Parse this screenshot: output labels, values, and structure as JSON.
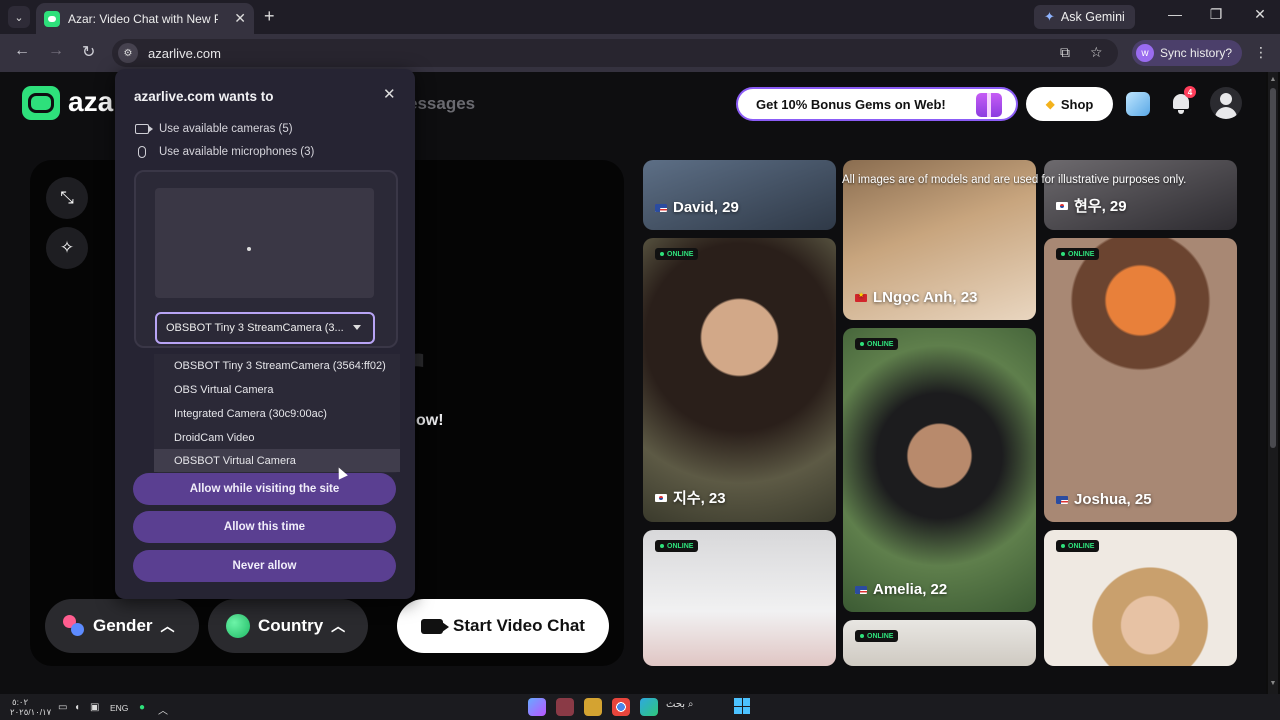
{
  "browser": {
    "tab_title": "Azar: Video Chat with New Peop",
    "url": "azarlive.com",
    "ask_gemini": "Ask Gemini",
    "sync": {
      "avatar_letter": "w",
      "label": "Sync history?"
    },
    "icons": [
      "tab-search-icon",
      "close-icon",
      "new-tab-icon",
      "back-icon",
      "forward-icon",
      "reload-icon",
      "site-info-icon",
      "install-app-icon",
      "bookmark-star-icon",
      "more-menu-icon",
      "minimize-icon",
      "maximize-icon"
    ]
  },
  "page": {
    "logo_text": "aza",
    "nav_messages": "essages",
    "promo": "Get 10% Bonus Gems on Web!",
    "shop": "Shop",
    "notification_count": "4",
    "ghost_letter": "r",
    "ghost_text": "ow!",
    "filters": {
      "gender": "Gender",
      "country": "Country"
    },
    "start_button": "Start Video Chat",
    "disclaimer": "All images are of models and are used for illustrative purposes only."
  },
  "cards": [
    {
      "label": "David, 29",
      "flag": "us",
      "online": false
    },
    {
      "label": "LNgọc Anh, 23",
      "flag": "vn",
      "online": false
    },
    {
      "label": "현우, 29",
      "flag": "kr",
      "online": false
    },
    {
      "label": "지수, 23",
      "flag": "kr",
      "online": true
    },
    {
      "label": "Amelia, 22",
      "flag": "us",
      "online": true
    },
    {
      "label": "Joshua, 25",
      "flag": "us",
      "online": true
    },
    {
      "label": "",
      "flag": "",
      "online": true
    },
    {
      "label": "",
      "flag": "",
      "online": true
    },
    {
      "label": "",
      "flag": "",
      "online": true
    }
  ],
  "online_text": "ONLINE",
  "permission": {
    "title": "azarlive.com wants to",
    "cameras": "Use available cameras (5)",
    "microphones": "Use available microphones (3)",
    "selected_camera": "OBSBOT Tiny 3 StreamCamera (3...",
    "camera_options": [
      "OBSBOT Tiny 3 StreamCamera (3564:ff02)",
      "OBS Virtual Camera",
      "Integrated Camera (30c9:00ac)",
      "DroidCam Video",
      "OBSBOT Virtual Camera"
    ],
    "buttons": {
      "allow_visiting": "Allow while visiting the site",
      "allow_once": "Allow this time",
      "never": "Never allow"
    }
  },
  "taskbar": {
    "time": "٥:٠٢",
    "date": "٢٠٢٥/١٠/١٧",
    "language": "ENG",
    "search": "بحث"
  }
}
